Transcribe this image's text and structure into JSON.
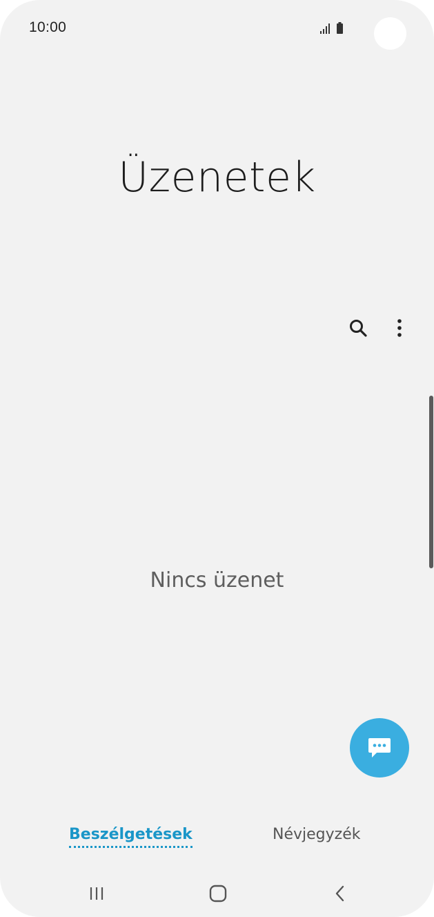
{
  "status_bar": {
    "time": "10:00",
    "signal_icon": "signal-icon",
    "battery_icon": "battery-icon"
  },
  "app": {
    "title": "Üzenetek"
  },
  "toolbar": {
    "search_icon": "search-icon",
    "more_icon": "more-options-icon"
  },
  "main": {
    "empty_message": "Nincs üzenet"
  },
  "fab": {
    "icon": "compose-message-icon",
    "color": "#3aaee0"
  },
  "tabs": [
    {
      "label": "Beszélgetések",
      "active": true
    },
    {
      "label": "Névjegyzék",
      "active": false
    }
  ],
  "colors": {
    "accent": "#1a96c8",
    "background": "#f2f2f2"
  },
  "navbar": {
    "recent_icon": "recent-apps-icon",
    "home_icon": "home-icon",
    "back_icon": "back-icon"
  }
}
